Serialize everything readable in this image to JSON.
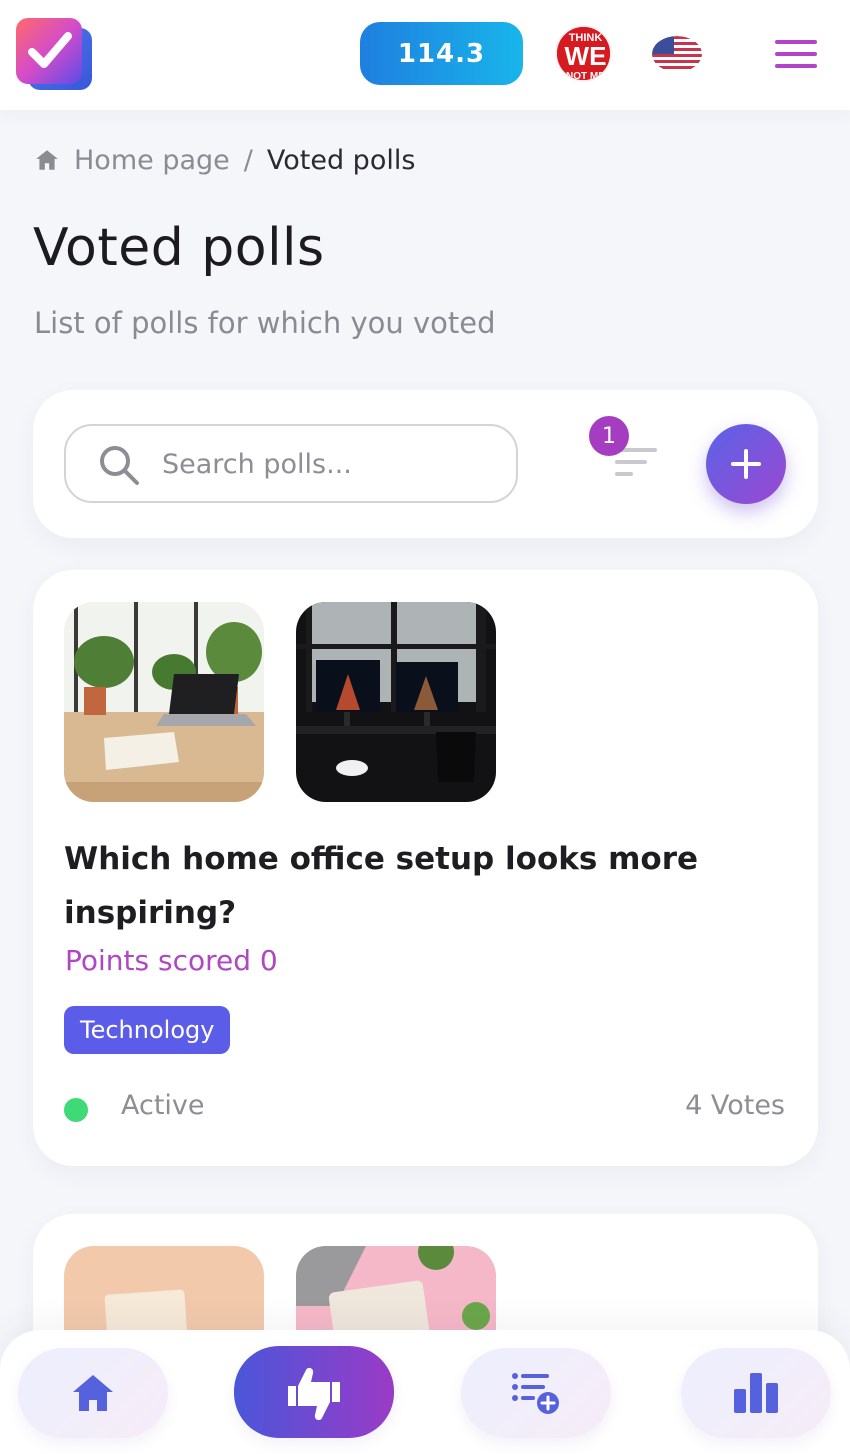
{
  "header": {
    "score": "114.3",
    "avatar_text": [
      "THINK",
      "WE",
      "NOT ME"
    ]
  },
  "breadcrumb": {
    "home": "Home page",
    "separator": "/",
    "current": "Voted polls"
  },
  "page": {
    "title": "Voted polls",
    "subtitle": "List of polls for which you voted"
  },
  "search": {
    "placeholder": "Search polls...",
    "filter_count": "1"
  },
  "polls": [
    {
      "question": "Which home office setup looks more inspiring?",
      "points": "Points scored 0",
      "category": "Technology",
      "status": "Active",
      "votes": "4 Votes"
    }
  ],
  "colors": {
    "accent_purple": "#b046c4",
    "tag_blue": "#5b5ce8",
    "status_active": "#3fd976",
    "score_gradient_start": "#1f7fe0",
    "score_gradient_end": "#18b5ea"
  },
  "icons": {
    "logo": "check-logo-icon",
    "menu": "hamburger-menu-icon",
    "breadcrumb_home": "home-icon",
    "search": "search-icon",
    "filter": "filter-icon",
    "add": "plus-icon",
    "nav_home": "home-icon",
    "nav_voted": "thumbs-up-down-icon",
    "nav_create": "list-add-icon",
    "nav_stats": "bar-chart-icon"
  }
}
